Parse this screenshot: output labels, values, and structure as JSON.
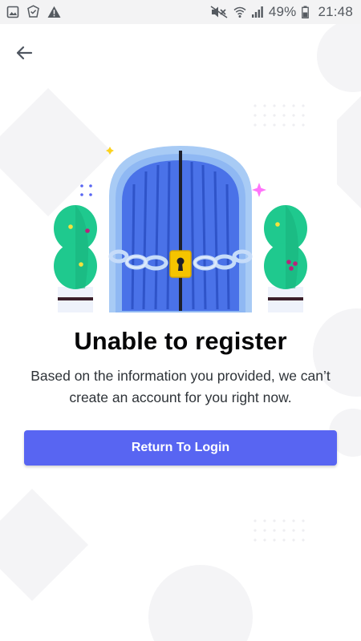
{
  "status_bar": {
    "icons_left": [
      "gallery-icon",
      "shield-check-icon",
      "warning-icon"
    ],
    "icons_right": [
      "mute-icon",
      "wifi-icon",
      "signal-icon",
      "battery-icon"
    ],
    "battery": "49%",
    "time": "21:48"
  },
  "header": {
    "back_icon": "arrow-left-icon"
  },
  "main": {
    "title": "Unable to register",
    "description": "Based on the information you provided, we can’t create an account for you right now.",
    "button_label": "Return To Login"
  },
  "colors": {
    "accent": "#5865f2",
    "door": "#4a72e8",
    "door_frame": "#a8cbf5",
    "plant": "#1fc98e",
    "lock": "#f5c400",
    "sparkle_pink": "#ff73fa",
    "sparkle_yellow": "#fcd21c",
    "sparkle_blue": "#5865f2"
  },
  "illustration": {
    "name": "locked-door-illustration"
  }
}
